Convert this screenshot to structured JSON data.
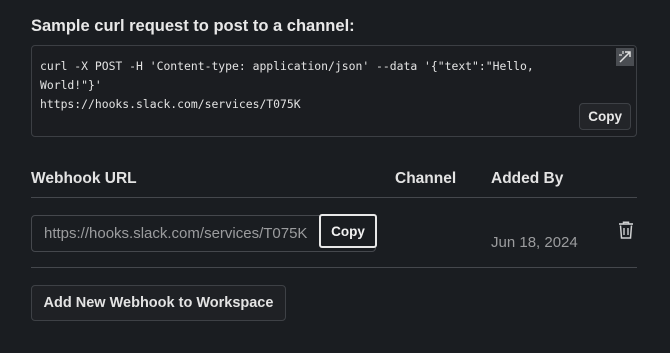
{
  "sample": {
    "title": "Sample curl request to post to a channel:",
    "code": "curl -X POST -H 'Content-type: application/json' --data '{\"text\":\"Hello, World!\"}'\nhttps://hooks.slack.com/services/T075K",
    "copy_label": "Copy"
  },
  "table": {
    "headers": {
      "webhook_url": "Webhook URL",
      "channel": "Channel",
      "added_by": "Added By"
    },
    "rows": [
      {
        "url": "https://hooks.slack.com/services/T075K",
        "copy_label": "Copy",
        "channel": "",
        "added_date": "Jun 18, 2024"
      }
    ]
  },
  "add_button_label": "Add New Webhook to Workspace"
}
